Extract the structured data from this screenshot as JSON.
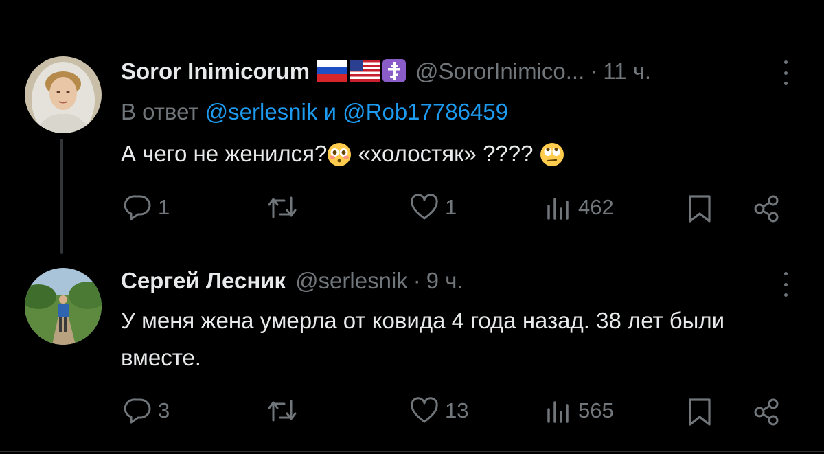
{
  "top_partial_text": "",
  "colors": {
    "background": "#000000",
    "text": "#e7e9ea",
    "muted": "#71767b",
    "link": "#1d9bf0"
  },
  "tweets": [
    {
      "name": "Soror Inimicorum",
      "badges": [
        "russia-flag-icon",
        "usa-flag-icon",
        "orthodox-cross-icon"
      ],
      "handle": "@SororInimico...",
      "dot": "·",
      "time": "11 ч.",
      "reply_prefix": "В ответ",
      "reply_mention1": "@serlesnik",
      "reply_and": "и",
      "reply_mention2": "@Rob17786459",
      "text_part1": "А чего не женился?",
      "text_part2": " «холостяк» ???? ",
      "actions": {
        "replies": "1",
        "retweets": "",
        "likes": "1",
        "views": "462"
      }
    },
    {
      "name": "Сергей Лесник",
      "handle": "@serlesnik",
      "dot": "·",
      "time": "9 ч.",
      "text": "У меня жена умерла от ковида 4 года назад. 38 лет были вместе.",
      "actions": {
        "replies": "3",
        "retweets": "",
        "likes": "13",
        "views": "565"
      }
    }
  ]
}
